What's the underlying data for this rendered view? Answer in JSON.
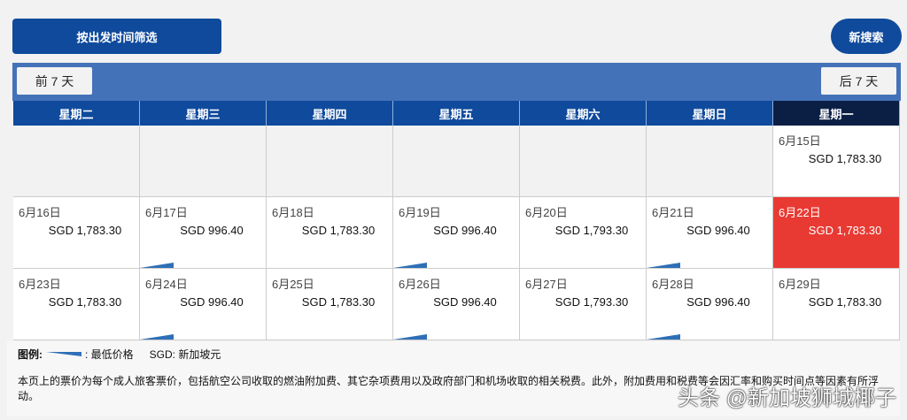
{
  "toolbar": {
    "filter_label": "按出发时间筛选",
    "search_label": "新搜索"
  },
  "nav": {
    "prev_label": "前 7 天",
    "next_label": "后 7 天"
  },
  "weekdays": [
    "星期二",
    "星期三",
    "星期四",
    "星期五",
    "星期六",
    "星期日",
    "星期一"
  ],
  "active_weekday": "星期一",
  "rows": [
    [
      null,
      null,
      null,
      null,
      null,
      null,
      {
        "date": "6月15日",
        "price": "SGD 1,783.30",
        "lowest": false
      }
    ],
    [
      {
        "date": "6月16日",
        "price": "SGD 1,783.30",
        "lowest": false
      },
      {
        "date": "6月17日",
        "price": "SGD 996.40",
        "lowest": true
      },
      {
        "date": "6月18日",
        "price": "SGD 1,783.30",
        "lowest": false
      },
      {
        "date": "6月19日",
        "price": "SGD 996.40",
        "lowest": true
      },
      {
        "date": "6月20日",
        "price": "SGD 1,793.30",
        "lowest": false
      },
      {
        "date": "6月21日",
        "price": "SGD 996.40",
        "lowest": true
      },
      {
        "date": "6月22日",
        "price": "SGD 1,783.30",
        "lowest": false,
        "selected": true
      }
    ],
    [
      {
        "date": "6月23日",
        "price": "SGD 1,783.30",
        "lowest": false
      },
      {
        "date": "6月24日",
        "price": "SGD 996.40",
        "lowest": true
      },
      {
        "date": "6月25日",
        "price": "SGD 1,783.30",
        "lowest": false
      },
      {
        "date": "6月26日",
        "price": "SGD 996.40",
        "lowest": true
      },
      {
        "date": "6月27日",
        "price": "SGD 1,793.30",
        "lowest": false
      },
      {
        "date": "6月28日",
        "price": "SGD 996.40",
        "lowest": true
      },
      {
        "date": "6月29日",
        "price": "SGD 1,783.30",
        "lowest": false
      }
    ]
  ],
  "legend": {
    "label": "图例:",
    "lowest_text": ": 最低价格",
    "currency_text": "SGD: 新加坡元",
    "note": "本页上的票价为每个成人旅客票价，包括航空公司收取的燃油附加费、其它杂项费用以及政府部门和机场收取的相关税费。此外，附加费用和税费等会因汇率和购买时间点等因素有所浮动。"
  },
  "watermark": "头条 @新加坡狮城椰子",
  "colors": {
    "primary": "#0f4a9c",
    "nav": "#4472b8",
    "selected": "#e83a33",
    "lowest_marker": "#2e6fb7"
  }
}
